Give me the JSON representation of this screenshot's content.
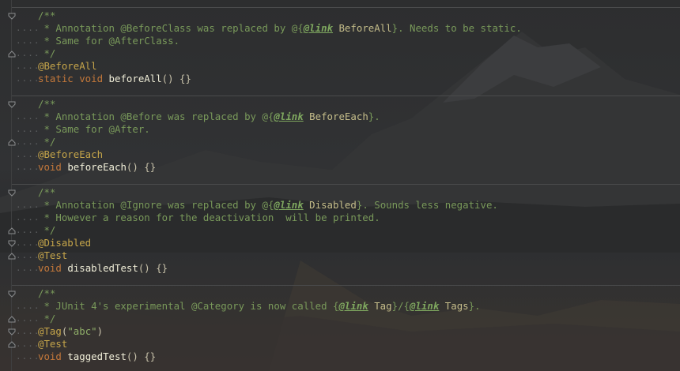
{
  "blocks": [
    {
      "lines": [
        {
          "ws": "",
          "fold": "open",
          "tokens": [
            {
              "t": "/**",
              "c": "cmt"
            }
          ]
        },
        {
          "ws": "....",
          "tokens": [
            {
              "t": " * Annotation @BeforeClass was replaced by @{",
              "c": "cmt"
            },
            {
              "t": "@link",
              "c": "tag"
            },
            {
              "t": " BeforeAll",
              "c": "ref"
            },
            {
              "t": "}. Needs to be static.",
              "c": "cmt"
            }
          ]
        },
        {
          "ws": "....",
          "tokens": [
            {
              "t": " * Same for @AfterClass.",
              "c": "cmt"
            }
          ]
        },
        {
          "ws": "....",
          "fold": "close",
          "tokens": [
            {
              "t": " */",
              "c": "cmt"
            }
          ]
        },
        {
          "ws": "....",
          "tokens": [
            {
              "t": "@BeforeAll",
              "c": "ann"
            }
          ]
        },
        {
          "ws": "....",
          "tokens": [
            {
              "t": "static void ",
              "c": "kw"
            },
            {
              "t": "beforeAll",
              "c": "fn"
            },
            {
              "t": "() {}",
              "c": "pun"
            }
          ]
        }
      ]
    },
    {
      "lines": [
        {
          "ws": "",
          "fold": "open",
          "tokens": [
            {
              "t": "/**",
              "c": "cmt"
            }
          ]
        },
        {
          "ws": "....",
          "tokens": [
            {
              "t": " * Annotation @Before was replaced by @{",
              "c": "cmt"
            },
            {
              "t": "@link",
              "c": "tag"
            },
            {
              "t": " BeforeEach",
              "c": "ref"
            },
            {
              "t": "}.",
              "c": "cmt"
            }
          ]
        },
        {
          "ws": "....",
          "tokens": [
            {
              "t": " * Same for @After.",
              "c": "cmt"
            }
          ]
        },
        {
          "ws": "....",
          "fold": "close",
          "tokens": [
            {
              "t": " */",
              "c": "cmt"
            }
          ]
        },
        {
          "ws": "....",
          "tokens": [
            {
              "t": "@BeforeEach",
              "c": "ann"
            }
          ]
        },
        {
          "ws": "....",
          "tokens": [
            {
              "t": "void ",
              "c": "kw"
            },
            {
              "t": "beforeEach",
              "c": "fn"
            },
            {
              "t": "() {}",
              "c": "pun"
            }
          ]
        }
      ]
    },
    {
      "lines": [
        {
          "ws": "",
          "fold": "open",
          "tokens": [
            {
              "t": "/**",
              "c": "cmt"
            }
          ]
        },
        {
          "ws": "....",
          "tokens": [
            {
              "t": " * Annotation @Ignore was replaced by @{",
              "c": "cmt"
            },
            {
              "t": "@link",
              "c": "tag"
            },
            {
              "t": " Disabled",
              "c": "ref"
            },
            {
              "t": "}. Sounds less negative.",
              "c": "cmt"
            }
          ]
        },
        {
          "ws": "....",
          "tokens": [
            {
              "t": " * However a reason for the deactivation  will be printed.",
              "c": "cmt"
            }
          ]
        },
        {
          "ws": "....",
          "fold": "close",
          "tokens": [
            {
              "t": " */",
              "c": "cmt"
            }
          ]
        },
        {
          "ws": "....",
          "fold": "open",
          "tokens": [
            {
              "t": "@Disabled",
              "c": "ann"
            }
          ]
        },
        {
          "ws": "....",
          "fold": "close",
          "tokens": [
            {
              "t": "@Test",
              "c": "ann"
            }
          ]
        },
        {
          "ws": "....",
          "tokens": [
            {
              "t": "void ",
              "c": "kw"
            },
            {
              "t": "disabledTest",
              "c": "fn"
            },
            {
              "t": "() {}",
              "c": "pun"
            }
          ]
        }
      ]
    },
    {
      "lines": [
        {
          "ws": "",
          "fold": "open",
          "tokens": [
            {
              "t": "/**",
              "c": "cmt"
            }
          ]
        },
        {
          "ws": "....",
          "tokens": [
            {
              "t": " * JUnit 4's experimental @Category is now called {",
              "c": "cmt"
            },
            {
              "t": "@link",
              "c": "tag"
            },
            {
              "t": " Tag",
              "c": "ref"
            },
            {
              "t": "}/{",
              "c": "cmt"
            },
            {
              "t": "@link",
              "c": "tag"
            },
            {
              "t": " Tags",
              "c": "ref"
            },
            {
              "t": "}.",
              "c": "cmt"
            }
          ]
        },
        {
          "ws": "....",
          "fold": "close",
          "tokens": [
            {
              "t": " */",
              "c": "cmt"
            }
          ]
        },
        {
          "ws": "....",
          "fold": "open",
          "tokens": [
            {
              "t": "@Tag",
              "c": "ann"
            },
            {
              "t": "(",
              "c": "pun"
            },
            {
              "t": "\"abc\"",
              "c": "str"
            },
            {
              "t": ")",
              "c": "pun"
            }
          ]
        },
        {
          "ws": "....",
          "fold": "close",
          "tokens": [
            {
              "t": "@Test",
              "c": "ann"
            }
          ]
        },
        {
          "ws": "....",
          "tokens": [
            {
              "t": "void ",
              "c": "kw"
            },
            {
              "t": "taggedTest",
              "c": "fn"
            },
            {
              "t": "() {}",
              "c": "pun"
            }
          ]
        }
      ]
    }
  ]
}
